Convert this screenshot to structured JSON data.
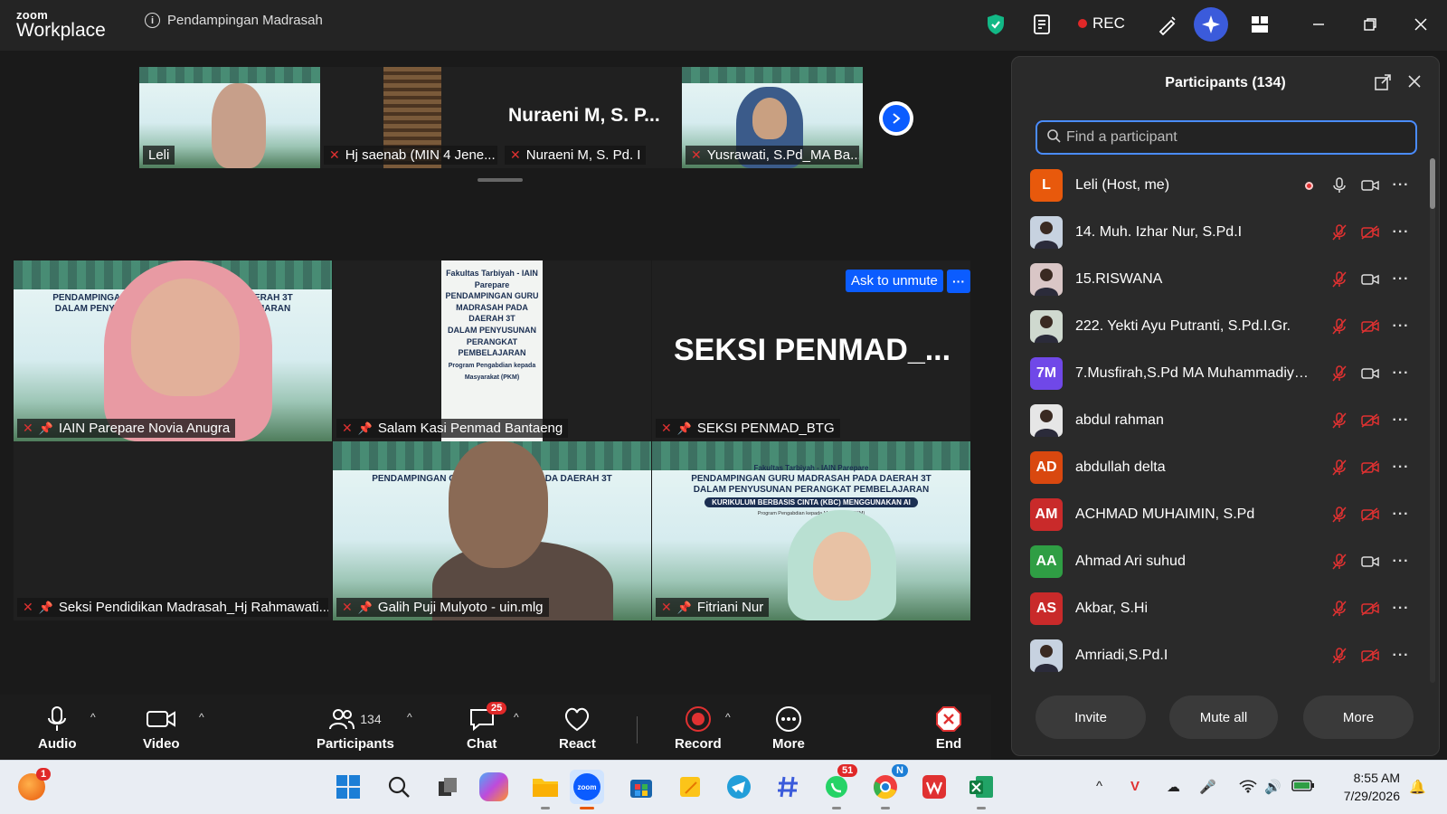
{
  "app": {
    "logo_small": "zoom",
    "logo_large": "Workplace",
    "meeting_title": "Pendampingan Madrasah",
    "rec_label": "REC"
  },
  "banner": {
    "line1": "Fakultas Tarbiyah - IAIN Parepare",
    "line2": "PENDAMPINGAN GURU MADRASAH PADA DAERAH 3T",
    "line3": "DALAM PENYUSUNAN PERANGKAT PEMBELAJARAN",
    "pill": "KURIKULUM BERBASIS CINTA (KBC) MENGGUNAKAN AI",
    "line4": "Program Pengabdian kepada Masyarakat (PKM)"
  },
  "thumbs": [
    {
      "name": "Leli",
      "active": true
    },
    {
      "name": "Hj saenab (MIN 4 Jene..."
    },
    {
      "name": "Nuraeni M, S. Pd. I",
      "big": "Nuraeni M, S. P..."
    },
    {
      "name": "Yusrawati, S.Pd_MA Ba..."
    }
  ],
  "tiles": [
    {
      "name": "IAIN Parepare Novia Anugra"
    },
    {
      "name": "Salam  Kasi Penmad Bantaeng"
    },
    {
      "name": "SEKSI PENMAD_BTG",
      "big": "SEKSI  PENMAD_...",
      "ask": "Ask to unmute",
      "more": "···"
    },
    {
      "name": "Seksi Pendidikan Madrasah_Hj Rahmawati..."
    },
    {
      "name": "Galih Puji Mulyoto - uin.mlg"
    },
    {
      "name": "Fitriani Nur"
    }
  ],
  "toolbar": {
    "audio": "Audio",
    "video": "Video",
    "participants": "Participants",
    "participants_count": "134",
    "chat": "Chat",
    "chat_badge": "25",
    "react": "React",
    "record": "Record",
    "more": "More",
    "end": "End"
  },
  "panel": {
    "title": "Participants (134)",
    "search_placeholder": "Find a participant",
    "participants": [
      {
        "name": "Leli (Host, me)",
        "initials": "L",
        "color": "#e8590c",
        "mic": "on",
        "video": "on",
        "rec": true
      },
      {
        "name": "14. Muh. Izhar Nur, S.Pd.I",
        "initials": "",
        "color": "#c7d2e0",
        "photo": true,
        "mic": "off",
        "video": "off"
      },
      {
        "name": "15.RISWANA",
        "initials": "",
        "color": "#d9c6c6",
        "photo": true,
        "mic": "off",
        "video": "on"
      },
      {
        "name": "222. Yekti Ayu Putranti, S.Pd.I.Gr.",
        "initials": "",
        "color": "#cfd9cf",
        "photo": true,
        "mic": "off",
        "video": "off"
      },
      {
        "name": "7.Musfirah,S.Pd MA Muhammadiya...",
        "initials": "7M",
        "color": "#7048e8",
        "mic": "off",
        "video": "on"
      },
      {
        "name": "abdul rahman",
        "initials": "",
        "color": "#e6e6e6",
        "photo": true,
        "mic": "off",
        "video": "off"
      },
      {
        "name": "abdullah delta",
        "initials": "AD",
        "color": "#d9480f",
        "mic": "off",
        "video": "off"
      },
      {
        "name": "ACHMAD MUHAIMIN, S.Pd",
        "initials": "AM",
        "color": "#c92a2a",
        "mic": "off",
        "video": "off"
      },
      {
        "name": "Ahmad Ari suhud",
        "initials": "AA",
        "color": "#2f9e44",
        "mic": "off",
        "video": "on"
      },
      {
        "name": "Akbar, S.Hi",
        "initials": "AS",
        "color": "#c92a2a",
        "mic": "off",
        "video": "off"
      },
      {
        "name": "Amriadi,S.Pd.I",
        "initials": "",
        "color": "#c7d2e0",
        "photo": true,
        "mic": "off",
        "video": "off"
      }
    ],
    "invite": "Invite",
    "mute_all": "Mute all",
    "more": "More"
  },
  "taskbar": {
    "time": "8:55 AM",
    "date": "7/29/2026",
    "notif_badge": "1",
    "whatsapp_badge": "51",
    "chrome_badge": "N"
  }
}
